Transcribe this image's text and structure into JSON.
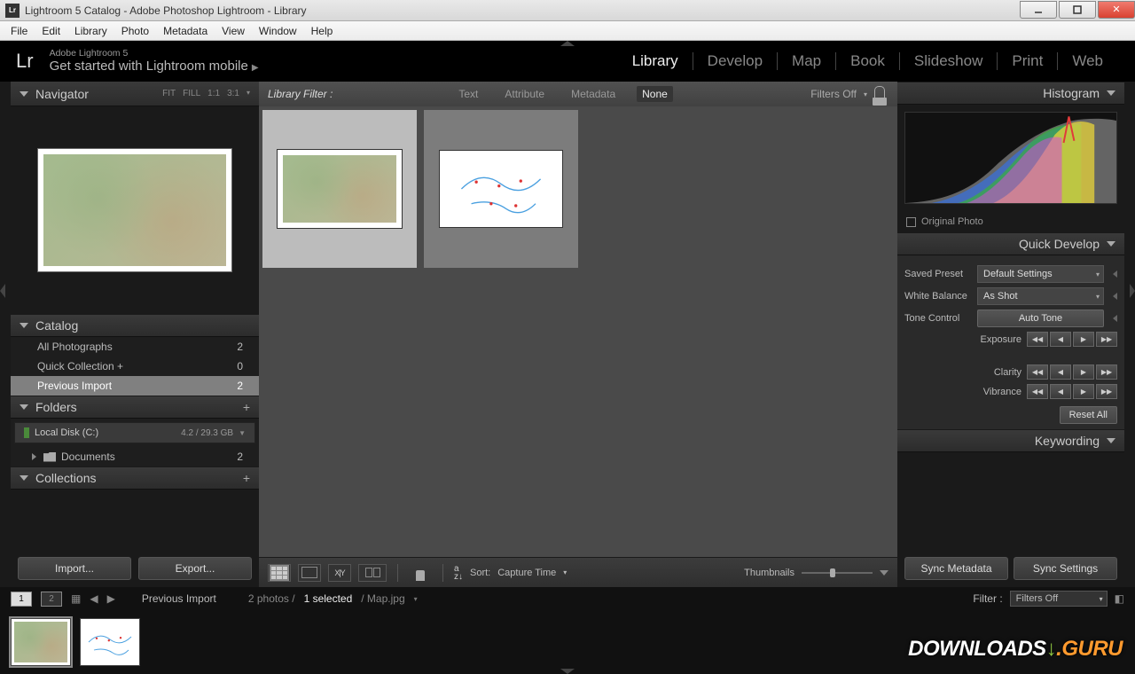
{
  "window": {
    "title": "Lightroom 5 Catalog - Adobe Photoshop Lightroom - Library",
    "app_icon": "Lr"
  },
  "menubar": [
    "File",
    "Edit",
    "Library",
    "Photo",
    "Metadata",
    "View",
    "Window",
    "Help"
  ],
  "identity": {
    "logo": "Lr",
    "line1": "Adobe Lightroom 5",
    "line2": "Get started with Lightroom mobile"
  },
  "modules": [
    "Library",
    "Develop",
    "Map",
    "Book",
    "Slideshow",
    "Print",
    "Web"
  ],
  "module_active": "Library",
  "navigator": {
    "title": "Navigator",
    "zoom_levels": [
      "FIT",
      "FILL",
      "1:1",
      "3:1"
    ]
  },
  "catalog": {
    "title": "Catalog",
    "items": [
      {
        "label": "All Photographs",
        "count": "2"
      },
      {
        "label": "Quick Collection  +",
        "count": "0"
      },
      {
        "label": "Previous Import",
        "count": "2"
      }
    ],
    "selected_index": 2
  },
  "folders": {
    "title": "Folders",
    "disk": {
      "name": "Local Disk (C:)",
      "usage": "4.2 / 29.3 GB"
    },
    "items": [
      {
        "label": "Documents",
        "count": "2"
      }
    ]
  },
  "collections": {
    "title": "Collections"
  },
  "buttons": {
    "import": "Import...",
    "export": "Export..."
  },
  "filter_bar": {
    "label": "Library Filter :",
    "tabs": [
      "Text",
      "Attribute",
      "Metadata",
      "None"
    ],
    "active": "None",
    "status": "Filters Off"
  },
  "toolbar": {
    "sort_label": "Sort:",
    "sort_value": "Capture Time",
    "thumb_label": "Thumbnails"
  },
  "right": {
    "histogram": {
      "title": "Histogram",
      "original": "Original Photo"
    },
    "quick_develop": {
      "title": "Quick Develop",
      "preset_label": "Saved Preset",
      "preset_value": "Default Settings",
      "wb_label": "White Balance",
      "wb_value": "As Shot",
      "tone_label": "Tone Control",
      "auto_tone": "Auto Tone",
      "exposure": "Exposure",
      "clarity": "Clarity",
      "vibrance": "Vibrance",
      "reset": "Reset All"
    },
    "keywording": {
      "title": "Keywording"
    },
    "sync_metadata": "Sync Metadata",
    "sync_settings": "Sync Settings"
  },
  "statusbar": {
    "mon1": "1",
    "mon2": "2",
    "breadcrumb": "Previous Import",
    "count": "2 photos /",
    "selected": "1 selected",
    "file": "/ Map.jpg",
    "filter_label": "Filter :",
    "filter_value": "Filters Off"
  },
  "watermark": {
    "a": "DOWNLOADS",
    "b": ".GURU"
  }
}
